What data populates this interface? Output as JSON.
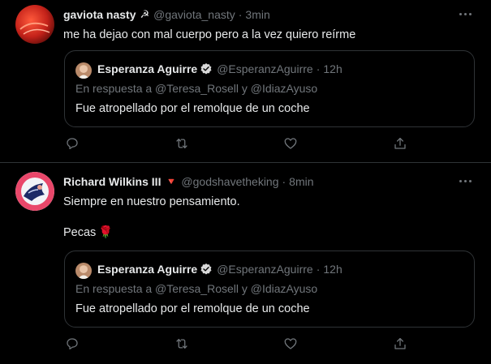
{
  "tweets": [
    {
      "display_name": "gaviota nasty",
      "name_emoji": "☭",
      "handle": "@gaviota_nasty",
      "time": "3min",
      "text": "me ha dejao con mal cuerpo pero a la vez quiero reírme",
      "quote": {
        "name": "Esperanza Aguirre",
        "handle": "@EsperanzAguirre",
        "time": "12h",
        "reply_to": "En respuesta a @Teresa_Rosell y @IdiazAyuso",
        "text": "Fue atropellado por el remolque de un coche"
      }
    },
    {
      "display_name": "Richard Wilkins III",
      "name_emoji": "🔻",
      "handle": "@godshavetheking",
      "time": "8min",
      "text": "Siempre en nuestro pensamiento.",
      "text2": "Pecas",
      "text2_emoji": "🌹",
      "quote": {
        "name": "Esperanza Aguirre",
        "handle": "@EsperanzAguirre",
        "time": "12h",
        "reply_to": "En respuesta a @Teresa_Rosell y @IdiazAyuso",
        "text": "Fue atropellado por el remolque de un coche"
      }
    }
  ],
  "separator": "·",
  "icons": [
    "more-icon",
    "reply-icon",
    "retweet-icon",
    "like-icon",
    "share-icon",
    "verified-icon"
  ],
  "colors": {
    "background": "#000000",
    "text": "#e7e9ea",
    "muted": "#71767b",
    "border": "#2f3336",
    "verified": "#d9d9d9",
    "triangle": "#f91880"
  }
}
